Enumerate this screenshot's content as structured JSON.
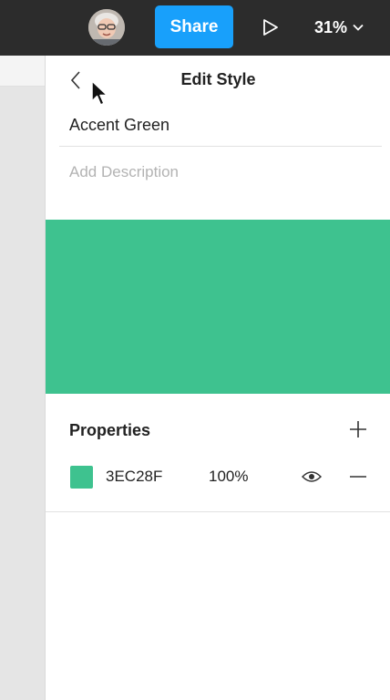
{
  "topbar": {
    "share_label": "Share",
    "zoom_value": "31%",
    "icons": {
      "avatar": "user-avatar",
      "play": "play-icon",
      "zoom_dropdown": "chevron-down-icon"
    }
  },
  "panel": {
    "title": "Edit Style",
    "style_name": "Accent Green",
    "description_placeholder": "Add Description",
    "preview_color": "#3ec28f",
    "properties": {
      "title": "Properties",
      "fills": [
        {
          "hex": "3EC28F",
          "opacity": "100%",
          "color": "#3ec28f"
        }
      ]
    }
  },
  "colors": {
    "topbar_bg": "#2c2c2c",
    "share_blue": "#18a0fb",
    "accent_green": "#3ec28f"
  }
}
